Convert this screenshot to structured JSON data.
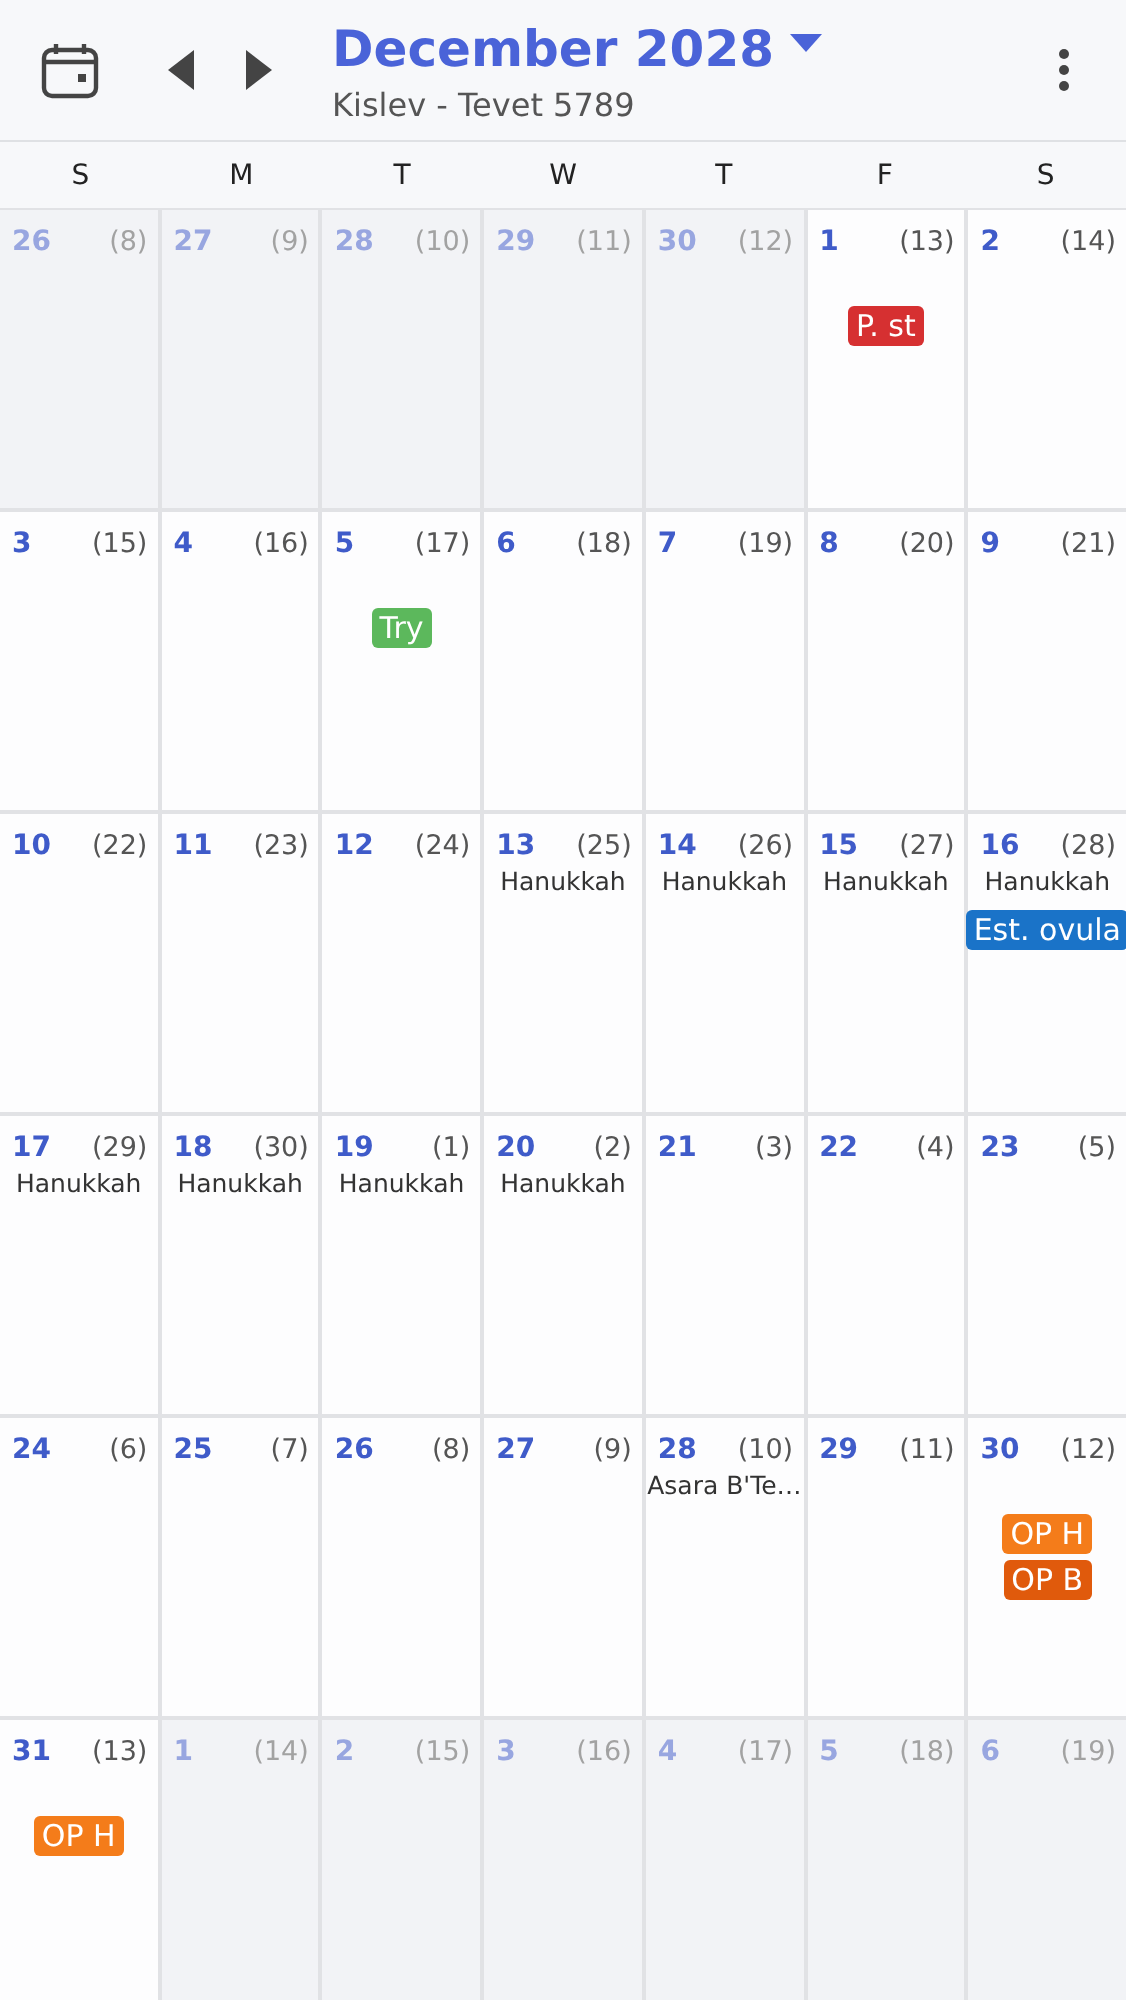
{
  "header": {
    "title": "December 2028",
    "subtitle": "Kislev - Tevet 5789"
  },
  "weekdays": [
    "S",
    "M",
    "T",
    "W",
    "T",
    "F",
    "S"
  ],
  "days": [
    {
      "day": "26",
      "hebrew": "(8)",
      "outside": true
    },
    {
      "day": "27",
      "hebrew": "(9)",
      "outside": true
    },
    {
      "day": "28",
      "hebrew": "(10)",
      "outside": true
    },
    {
      "day": "29",
      "hebrew": "(11)",
      "outside": true
    },
    {
      "day": "30",
      "hebrew": "(12)",
      "outside": true
    },
    {
      "day": "1",
      "hebrew": "(13)",
      "outside": false,
      "events": [
        {
          "label": "P. st",
          "color": "#d63031"
        }
      ]
    },
    {
      "day": "2",
      "hebrew": "(14)",
      "outside": false
    },
    {
      "day": "3",
      "hebrew": "(15)",
      "outside": false
    },
    {
      "day": "4",
      "hebrew": "(16)",
      "outside": false
    },
    {
      "day": "5",
      "hebrew": "(17)",
      "outside": false,
      "events": [
        {
          "label": "Try",
          "color": "#5cb85c"
        }
      ]
    },
    {
      "day": "6",
      "hebrew": "(18)",
      "outside": false
    },
    {
      "day": "7",
      "hebrew": "(19)",
      "outside": false
    },
    {
      "day": "8",
      "hebrew": "(20)",
      "outside": false
    },
    {
      "day": "9",
      "hebrew": "(21)",
      "outside": false
    },
    {
      "day": "10",
      "hebrew": "(22)",
      "outside": false
    },
    {
      "day": "11",
      "hebrew": "(23)",
      "outside": false
    },
    {
      "day": "12",
      "hebrew": "(24)",
      "outside": false
    },
    {
      "day": "13",
      "hebrew": "(25)",
      "outside": false,
      "holiday": "Hanukkah"
    },
    {
      "day": "14",
      "hebrew": "(26)",
      "outside": false,
      "holiday": "Hanukkah"
    },
    {
      "day": "15",
      "hebrew": "(27)",
      "outside": false,
      "holiday": "Hanukkah"
    },
    {
      "day": "16",
      "hebrew": "(28)",
      "outside": false,
      "holiday": "Hanukkah",
      "events": [
        {
          "label": "Est. ovula",
          "color": "#1a73c8"
        }
      ]
    },
    {
      "day": "17",
      "hebrew": "(29)",
      "outside": false,
      "holiday": "Hanukkah"
    },
    {
      "day": "18",
      "hebrew": "(30)",
      "outside": false,
      "holiday": "Hanukkah"
    },
    {
      "day": "19",
      "hebrew": "(1)",
      "outside": false,
      "holiday": "Hanukkah"
    },
    {
      "day": "20",
      "hebrew": "(2)",
      "outside": false,
      "holiday": "Hanukkah"
    },
    {
      "day": "21",
      "hebrew": "(3)",
      "outside": false
    },
    {
      "day": "22",
      "hebrew": "(4)",
      "outside": false
    },
    {
      "day": "23",
      "hebrew": "(5)",
      "outside": false
    },
    {
      "day": "24",
      "hebrew": "(6)",
      "outside": false
    },
    {
      "day": "25",
      "hebrew": "(7)",
      "outside": false
    },
    {
      "day": "26",
      "hebrew": "(8)",
      "outside": false
    },
    {
      "day": "27",
      "hebrew": "(9)",
      "outside": false
    },
    {
      "day": "28",
      "hebrew": "(10)",
      "outside": false,
      "holiday": "Asara B'Te…"
    },
    {
      "day": "29",
      "hebrew": "(11)",
      "outside": false
    },
    {
      "day": "30",
      "hebrew": "(12)",
      "outside": false,
      "events": [
        {
          "label": "OP H",
          "color": "#f47c1a"
        },
        {
          "label": "OP B",
          "color": "#e05a0c"
        }
      ]
    },
    {
      "day": "31",
      "hebrew": "(13)",
      "outside": false,
      "events": [
        {
          "label": "OP H",
          "color": "#f47c1a"
        }
      ]
    },
    {
      "day": "1",
      "hebrew": "(14)",
      "outside": true
    },
    {
      "day": "2",
      "hebrew": "(15)",
      "outside": true
    },
    {
      "day": "3",
      "hebrew": "(16)",
      "outside": true
    },
    {
      "day": "4",
      "hebrew": "(17)",
      "outside": true
    },
    {
      "day": "5",
      "hebrew": "(18)",
      "outside": true
    },
    {
      "day": "6",
      "hebrew": "(19)",
      "outside": true
    }
  ]
}
